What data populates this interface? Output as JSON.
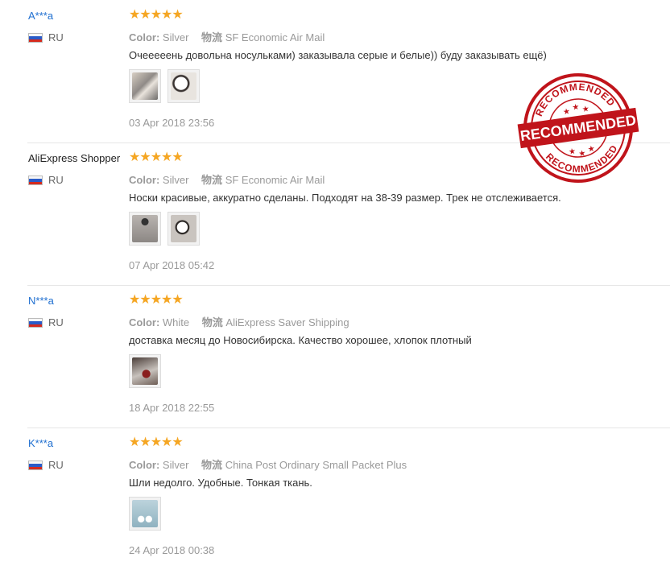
{
  "reviews": [
    {
      "user": "A***a",
      "country": "RU",
      "rating": 5,
      "color_label": "Color:",
      "color_value": "Silver",
      "shipping_label": "物流",
      "shipping_value": "SF Economic Air Mail",
      "text": "Очееееень довольна носульками) заказывала серые и белые)) буду заказывать ещё)",
      "date": "03 Apr 2018 23:56",
      "photos": [
        "sock-photo",
        "sock-photo"
      ]
    },
    {
      "user": "AliExpress Shopper",
      "country": "RU",
      "rating": 5,
      "color_label": "Color:",
      "color_value": "Silver",
      "shipping_label": "物流",
      "shipping_value": "SF Economic Air Mail",
      "text": "Носки красивые, аккуратно сделаны. Подходят на 38-39 размер. Трек не отслеживается.",
      "date": "07 Apr 2018 05:42",
      "photos": [
        "sock-photo",
        "sock-photo"
      ]
    },
    {
      "user": "N***a",
      "country": "RU",
      "rating": 5,
      "color_label": "Color:",
      "color_value": "White",
      "shipping_label": "物流",
      "shipping_value": "AliExpress Saver Shipping",
      "text": "доставка месяц до Новосибирска. Качество хорошее, хлопок плотный",
      "date": "18 Apr 2018 22:55",
      "photos": [
        "sock-photo"
      ]
    },
    {
      "user": "K***a",
      "country": "RU",
      "rating": 5,
      "color_label": "Color:",
      "color_value": "Silver",
      "shipping_label": "物流",
      "shipping_value": "China Post Ordinary Small Packet Plus",
      "text": "Шли недолго. Удобные. Тонкая ткань.",
      "date": "24 Apr 2018 00:38",
      "photos": [
        "sock-photo"
      ]
    }
  ],
  "stamp": {
    "top_text": "RECOMMENDED",
    "center_text": "RECOMMENDED",
    "bottom_text": "RECOMMENDED",
    "color": "#c0141b"
  },
  "star_color": "#f5a623",
  "link_color": "#1f6fd0"
}
